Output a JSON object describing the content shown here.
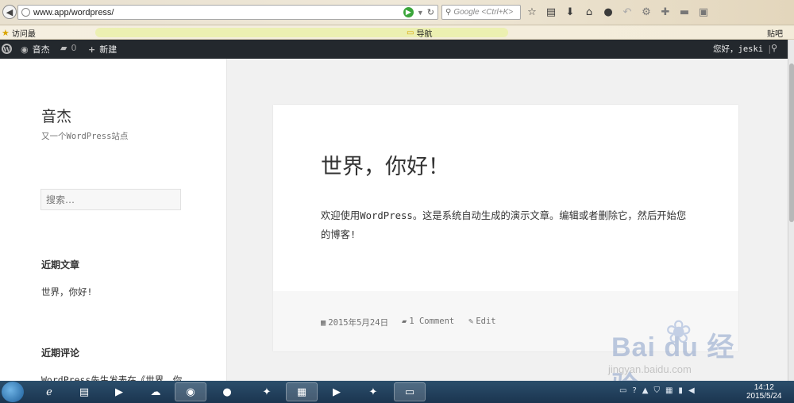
{
  "browser": {
    "url": "www.app/wordpress/",
    "search_placeholder": "Google <Ctrl+K>",
    "bookmarks": {
      "most_visited": "访问最",
      "item_right": "导航",
      "paste": "贴吧"
    },
    "toolbar_icons": [
      "star-icon",
      "clipboard-icon",
      "download-icon",
      "home-icon",
      "chat-icon",
      "undo-icon",
      "gear-icon",
      "puzzle-icon",
      "folder-icon",
      "window-icon"
    ]
  },
  "adminbar": {
    "site_name": "音杰",
    "comments_count": "0",
    "new_label": "新建",
    "greeting": "您好，jeski"
  },
  "sidebar": {
    "site_title": "音杰",
    "site_description": "又一个WordPress站点",
    "search_placeholder": "搜索…",
    "recent_posts_title": "近期文章",
    "recent_posts": [
      "世界，你好!"
    ],
    "recent_comments_title": "近期评论",
    "recent_comment_text": "WordPress先生发表在《世界，你"
  },
  "post": {
    "title": "世界，你好！",
    "content": "欢迎使用WordPress。这是系统自动生成的演示文章。编辑或者删除它，然后开始您的博客!",
    "date": "2015年5月24日",
    "comments": "1 Comment",
    "edit": "Edit"
  },
  "watermark": {
    "logo": "Bai du 经验",
    "url": "jingyan.baidu.com"
  },
  "taskbar": {
    "time": "14:12",
    "date": "2015/5/24"
  },
  "colors": {
    "admin_bar": "#23282d",
    "page_background": "#f1f1f1",
    "taskbar": "#1b3550"
  }
}
